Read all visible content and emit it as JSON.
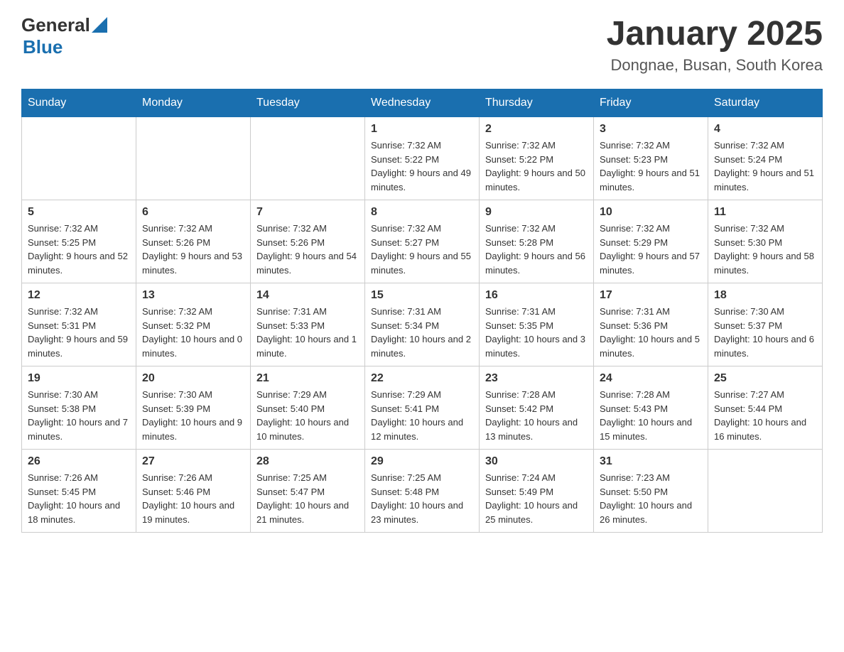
{
  "header": {
    "logo": {
      "general": "General",
      "blue": "Blue"
    },
    "title": "January 2025",
    "subtitle": "Dongnae, Busan, South Korea"
  },
  "weekdays": [
    "Sunday",
    "Monday",
    "Tuesday",
    "Wednesday",
    "Thursday",
    "Friday",
    "Saturday"
  ],
  "weeks": [
    [
      {
        "day": "",
        "info": ""
      },
      {
        "day": "",
        "info": ""
      },
      {
        "day": "",
        "info": ""
      },
      {
        "day": "1",
        "info": "Sunrise: 7:32 AM\nSunset: 5:22 PM\nDaylight: 9 hours and 49 minutes."
      },
      {
        "day": "2",
        "info": "Sunrise: 7:32 AM\nSunset: 5:22 PM\nDaylight: 9 hours and 50 minutes."
      },
      {
        "day": "3",
        "info": "Sunrise: 7:32 AM\nSunset: 5:23 PM\nDaylight: 9 hours and 51 minutes."
      },
      {
        "day": "4",
        "info": "Sunrise: 7:32 AM\nSunset: 5:24 PM\nDaylight: 9 hours and 51 minutes."
      }
    ],
    [
      {
        "day": "5",
        "info": "Sunrise: 7:32 AM\nSunset: 5:25 PM\nDaylight: 9 hours and 52 minutes."
      },
      {
        "day": "6",
        "info": "Sunrise: 7:32 AM\nSunset: 5:26 PM\nDaylight: 9 hours and 53 minutes."
      },
      {
        "day": "7",
        "info": "Sunrise: 7:32 AM\nSunset: 5:26 PM\nDaylight: 9 hours and 54 minutes."
      },
      {
        "day": "8",
        "info": "Sunrise: 7:32 AM\nSunset: 5:27 PM\nDaylight: 9 hours and 55 minutes."
      },
      {
        "day": "9",
        "info": "Sunrise: 7:32 AM\nSunset: 5:28 PM\nDaylight: 9 hours and 56 minutes."
      },
      {
        "day": "10",
        "info": "Sunrise: 7:32 AM\nSunset: 5:29 PM\nDaylight: 9 hours and 57 minutes."
      },
      {
        "day": "11",
        "info": "Sunrise: 7:32 AM\nSunset: 5:30 PM\nDaylight: 9 hours and 58 minutes."
      }
    ],
    [
      {
        "day": "12",
        "info": "Sunrise: 7:32 AM\nSunset: 5:31 PM\nDaylight: 9 hours and 59 minutes."
      },
      {
        "day": "13",
        "info": "Sunrise: 7:32 AM\nSunset: 5:32 PM\nDaylight: 10 hours and 0 minutes."
      },
      {
        "day": "14",
        "info": "Sunrise: 7:31 AM\nSunset: 5:33 PM\nDaylight: 10 hours and 1 minute."
      },
      {
        "day": "15",
        "info": "Sunrise: 7:31 AM\nSunset: 5:34 PM\nDaylight: 10 hours and 2 minutes."
      },
      {
        "day": "16",
        "info": "Sunrise: 7:31 AM\nSunset: 5:35 PM\nDaylight: 10 hours and 3 minutes."
      },
      {
        "day": "17",
        "info": "Sunrise: 7:31 AM\nSunset: 5:36 PM\nDaylight: 10 hours and 5 minutes."
      },
      {
        "day": "18",
        "info": "Sunrise: 7:30 AM\nSunset: 5:37 PM\nDaylight: 10 hours and 6 minutes."
      }
    ],
    [
      {
        "day": "19",
        "info": "Sunrise: 7:30 AM\nSunset: 5:38 PM\nDaylight: 10 hours and 7 minutes."
      },
      {
        "day": "20",
        "info": "Sunrise: 7:30 AM\nSunset: 5:39 PM\nDaylight: 10 hours and 9 minutes."
      },
      {
        "day": "21",
        "info": "Sunrise: 7:29 AM\nSunset: 5:40 PM\nDaylight: 10 hours and 10 minutes."
      },
      {
        "day": "22",
        "info": "Sunrise: 7:29 AM\nSunset: 5:41 PM\nDaylight: 10 hours and 12 minutes."
      },
      {
        "day": "23",
        "info": "Sunrise: 7:28 AM\nSunset: 5:42 PM\nDaylight: 10 hours and 13 minutes."
      },
      {
        "day": "24",
        "info": "Sunrise: 7:28 AM\nSunset: 5:43 PM\nDaylight: 10 hours and 15 minutes."
      },
      {
        "day": "25",
        "info": "Sunrise: 7:27 AM\nSunset: 5:44 PM\nDaylight: 10 hours and 16 minutes."
      }
    ],
    [
      {
        "day": "26",
        "info": "Sunrise: 7:26 AM\nSunset: 5:45 PM\nDaylight: 10 hours and 18 minutes."
      },
      {
        "day": "27",
        "info": "Sunrise: 7:26 AM\nSunset: 5:46 PM\nDaylight: 10 hours and 19 minutes."
      },
      {
        "day": "28",
        "info": "Sunrise: 7:25 AM\nSunset: 5:47 PM\nDaylight: 10 hours and 21 minutes."
      },
      {
        "day": "29",
        "info": "Sunrise: 7:25 AM\nSunset: 5:48 PM\nDaylight: 10 hours and 23 minutes."
      },
      {
        "day": "30",
        "info": "Sunrise: 7:24 AM\nSunset: 5:49 PM\nDaylight: 10 hours and 25 minutes."
      },
      {
        "day": "31",
        "info": "Sunrise: 7:23 AM\nSunset: 5:50 PM\nDaylight: 10 hours and 26 minutes."
      },
      {
        "day": "",
        "info": ""
      }
    ]
  ]
}
